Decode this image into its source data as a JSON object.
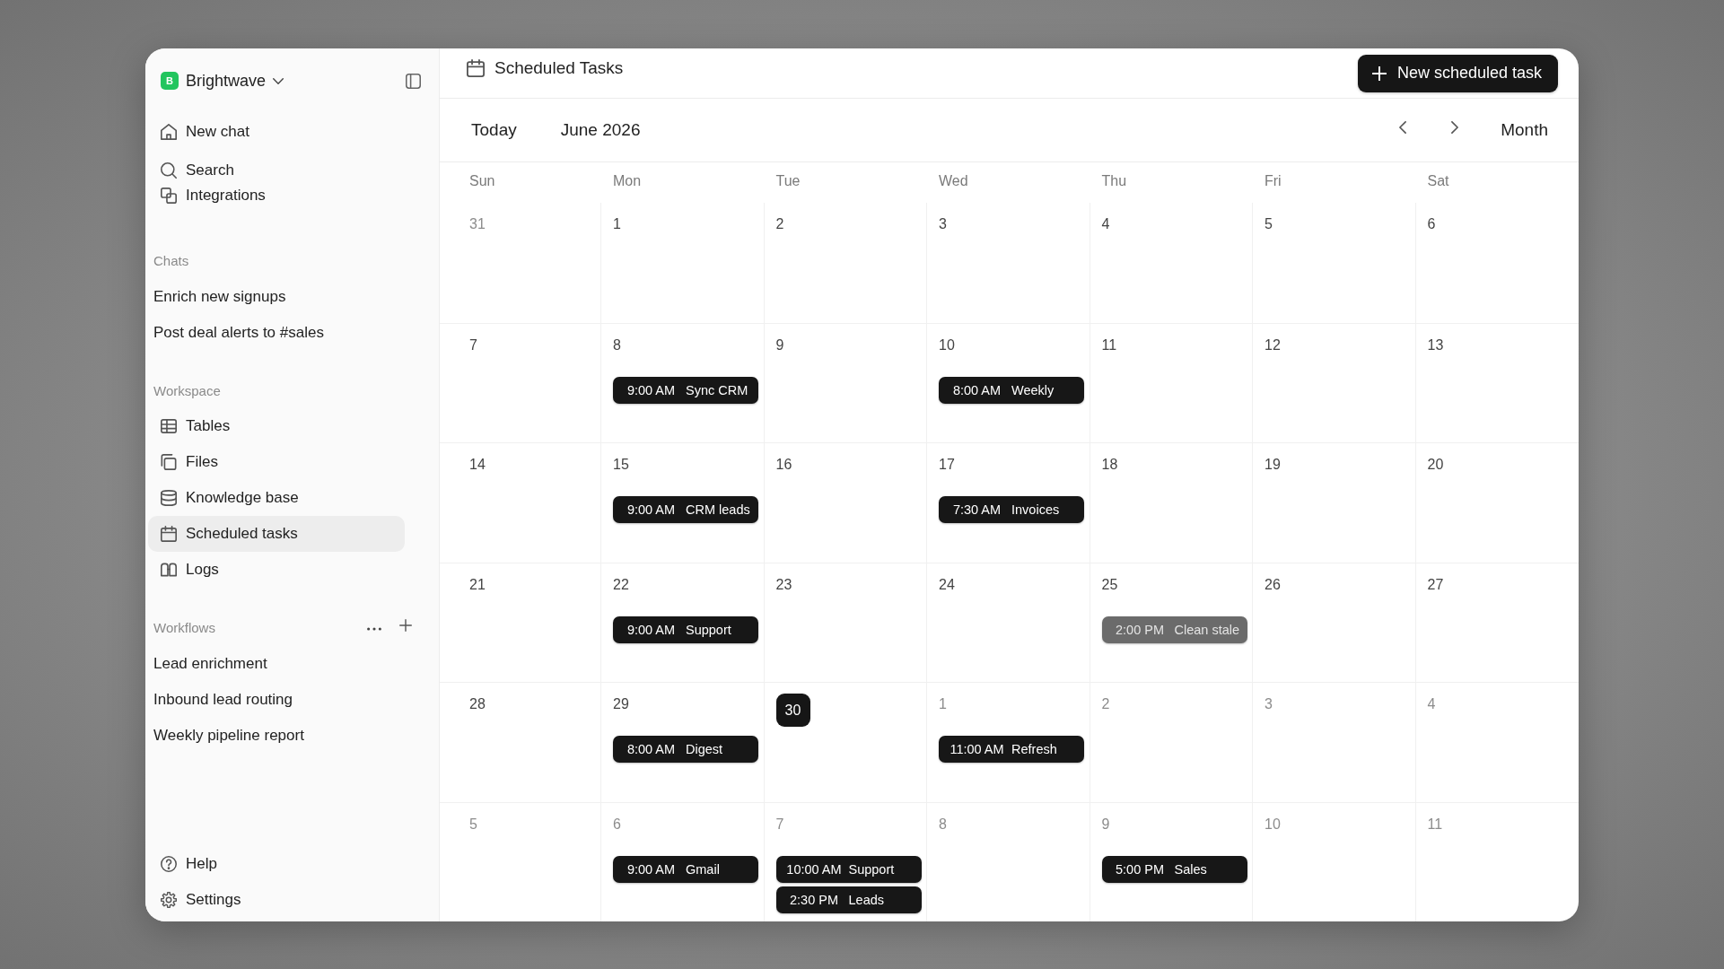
{
  "sidebar": {
    "workspace": {
      "initial": "B",
      "name": "Brightwave"
    },
    "nav": [
      "New chat",
      "Search",
      "Integrations"
    ],
    "chats": {
      "title": "Chats",
      "items": [
        {
          "label": "Enrich new signups",
          "selected": false
        },
        {
          "label": "Post deal alerts to #sales",
          "selected": false
        }
      ]
    },
    "workspace_section": {
      "title": "Workspace",
      "items": [
        {
          "label": "Tables",
          "selected": false
        },
        {
          "label": "Files",
          "selected": false
        },
        {
          "label": "Knowledge base",
          "selected": false
        },
        {
          "label": "Scheduled tasks",
          "selected": true
        },
        {
          "label": "Logs",
          "selected": false
        }
      ]
    },
    "workflows": {
      "title": "Workflows",
      "items": [
        {
          "label": "Lead enrichment",
          "selected": false
        },
        {
          "label": "Inbound lead routing",
          "selected": false
        },
        {
          "label": "Weekly pipeline report",
          "selected": false
        }
      ]
    },
    "footer": [
      "Help",
      "Settings"
    ]
  },
  "header": {
    "title": "Scheduled Tasks",
    "new_task_button": "New scheduled task"
  },
  "toolbar": {
    "today_button": "Today",
    "period": "June 2026",
    "view": "Month"
  },
  "calendar": {
    "weekdays": [
      "Sun",
      "Mon",
      "Tue",
      "Wed",
      "Thu",
      "Fri",
      "Sat"
    ],
    "weeks": [
      [
        {
          "date": "31",
          "outside_month": true,
          "today": false
        },
        {
          "date": "1",
          "outside_month": false,
          "today": false
        },
        {
          "date": "2",
          "outside_month": false,
          "today": false
        },
        {
          "date": "3",
          "outside_month": false,
          "today": false
        },
        {
          "date": "4",
          "outside_month": false,
          "today": false
        },
        {
          "date": "5",
          "outside_month": false,
          "today": false
        },
        {
          "date": "6",
          "outside_month": false,
          "today": false
        }
      ],
      [
        {
          "date": "7",
          "outside_month": false,
          "today": false
        },
        {
          "date": "8",
          "outside_month": false,
          "today": false,
          "events": [
            {
              "time": "9:00 AM",
              "title": "Sync CRM",
              "paused": false
            }
          ]
        },
        {
          "date": "9",
          "outside_month": false,
          "today": false
        },
        {
          "date": "10",
          "outside_month": false,
          "today": false,
          "events": [
            {
              "time": "8:00 AM",
              "title": "Weekly",
              "paused": false
            }
          ]
        },
        {
          "date": "11",
          "outside_month": false,
          "today": false
        },
        {
          "date": "12",
          "outside_month": false,
          "today": false
        },
        {
          "date": "13",
          "outside_month": false,
          "today": false
        }
      ],
      [
        {
          "date": "14",
          "outside_month": false,
          "today": false
        },
        {
          "date": "15",
          "outside_month": false,
          "today": false,
          "events": [
            {
              "time": "9:00 AM",
              "title": "CRM leads",
              "paused": false
            }
          ]
        },
        {
          "date": "16",
          "outside_month": false,
          "today": false
        },
        {
          "date": "17",
          "outside_month": false,
          "today": false,
          "events": [
            {
              "time": "7:30 AM",
              "title": "Invoices",
              "paused": false
            }
          ]
        },
        {
          "date": "18",
          "outside_month": false,
          "today": false
        },
        {
          "date": "19",
          "outside_month": false,
          "today": false
        },
        {
          "date": "20",
          "outside_month": false,
          "today": false
        }
      ],
      [
        {
          "date": "21",
          "outside_month": false,
          "today": false
        },
        {
          "date": "22",
          "outside_month": false,
          "today": false,
          "events": [
            {
              "time": "9:00 AM",
              "title": "Support",
              "paused": false
            }
          ]
        },
        {
          "date": "23",
          "outside_month": false,
          "today": false
        },
        {
          "date": "24",
          "outside_month": false,
          "today": false
        },
        {
          "date": "25",
          "outside_month": false,
          "today": false,
          "events": [
            {
              "time": "2:00 PM",
              "title": "Clean stale",
              "paused": true
            }
          ]
        },
        {
          "date": "26",
          "outside_month": false,
          "today": false
        },
        {
          "date": "27",
          "outside_month": false,
          "today": false
        }
      ],
      [
        {
          "date": "28",
          "outside_month": false,
          "today": false
        },
        {
          "date": "29",
          "outside_month": false,
          "today": false,
          "events": [
            {
              "time": "8:00 AM",
              "title": "Digest",
              "paused": false
            }
          ]
        },
        {
          "date": "30",
          "outside_month": false,
          "today": true
        },
        {
          "date": "1",
          "outside_month": true,
          "today": false,
          "events": [
            {
              "time": "11:00 AM",
              "title": "Refresh",
              "paused": false
            }
          ]
        },
        {
          "date": "2",
          "outside_month": true,
          "today": false
        },
        {
          "date": "3",
          "outside_month": true,
          "today": false
        },
        {
          "date": "4",
          "outside_month": true,
          "today": false
        }
      ],
      [
        {
          "date": "5",
          "outside_month": true,
          "today": false
        },
        {
          "date": "6",
          "outside_month": true,
          "today": false,
          "events": [
            {
              "time": "9:00 AM",
              "title": "Gmail",
              "paused": false
            }
          ]
        },
        {
          "date": "7",
          "outside_month": true,
          "today": false,
          "events": [
            {
              "time": "10:00 AM",
              "title": "Support",
              "paused": false
            },
            {
              "time": "2:30 PM",
              "title": "Leads",
              "paused": false
            }
          ]
        },
        {
          "date": "8",
          "outside_month": true,
          "today": false
        },
        {
          "date": "9",
          "outside_month": true,
          "today": false,
          "events": [
            {
              "time": "5:00 PM",
              "title": "Sales",
              "paused": false
            }
          ]
        },
        {
          "date": "10",
          "outside_month": true,
          "today": false
        },
        {
          "date": "11",
          "outside_month": true,
          "today": false
        }
      ]
    ]
  }
}
